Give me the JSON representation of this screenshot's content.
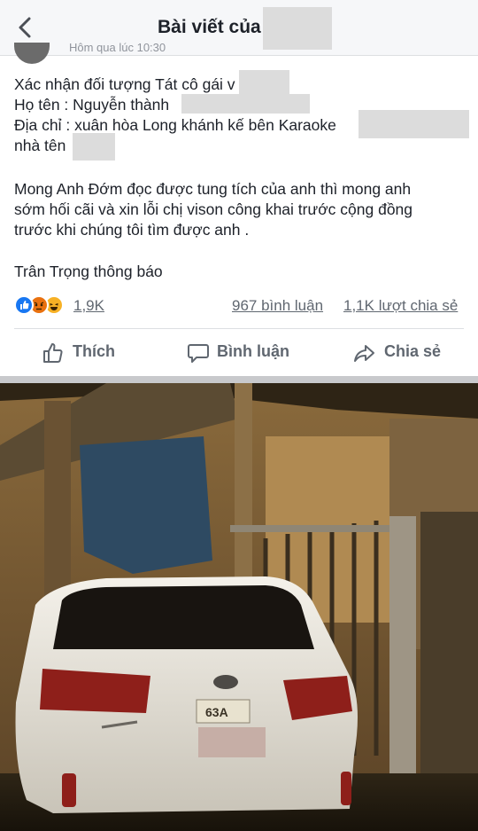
{
  "header": {
    "title": "Bài viết của",
    "back_icon": "chevron-left-icon"
  },
  "post": {
    "meta": "Hôm qua lúc 10:30",
    "lines": [
      "Xác nhận đối tượng Tát cô gái v",
      "Họ tên : Nguyễn thành",
      "Địa chỉ : xuân hòa Long khánh kế bên Karaoke",
      "nhà tên",
      "Mong Anh Đớm đọc được tung tích của anh thì mong anh",
      "sớm hối cãi và xin lỗi chị vison công khai trước cộng đồng",
      "trước khi chúng tôi tìm được anh .",
      "Trân Trọng thông báo"
    ]
  },
  "stats": {
    "reactions_count": "1,9K",
    "comments": "967 bình luận",
    "shares": "1,1K lượt chia sẻ",
    "reaction_icons": [
      "like-icon",
      "angry-icon",
      "haha-icon"
    ]
  },
  "actions": {
    "like": "Thích",
    "comment": "Bình luận",
    "share": "Chia sẻ"
  },
  "photo": {
    "plate_text": "63A"
  },
  "colors": {
    "header_bg": "#f6f7f9",
    "text": "#1d2129",
    "secondary_text": "#606770",
    "like_blue": "#1877f2",
    "angry": "#e9710f",
    "haha": "#f7b125"
  }
}
